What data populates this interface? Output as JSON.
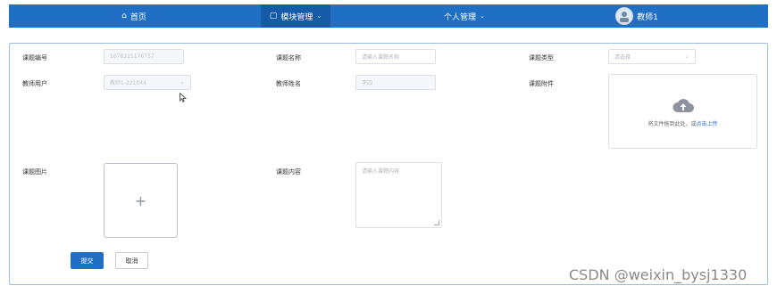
{
  "nav": {
    "home": {
      "icon": "home-icon",
      "label": "首页"
    },
    "module": {
      "icon": "document-icon",
      "label": "模块管理"
    },
    "personal": {
      "label": "个人管理"
    },
    "user": {
      "name": "教师1"
    }
  },
  "form": {
    "course_no": {
      "label": "课题编号",
      "value": "1678215176737"
    },
    "course_name": {
      "label": "课题名称",
      "placeholder": "请输入课题名称"
    },
    "course_type": {
      "label": "课题类型",
      "placeholder": "请选择"
    },
    "teacher_user": {
      "label": "教师用户",
      "value": "教师1-221044"
    },
    "teacher_name": {
      "label": "教师姓名",
      "value": "李四"
    },
    "attachment": {
      "label": "课题附件",
      "text": "将文件拖到此处，或",
      "link": "点击上传"
    },
    "picture": {
      "label": "课题图片",
      "plus": "+"
    },
    "content": {
      "label": "课题内容",
      "placeholder": "请输入课题内容"
    }
  },
  "buttons": {
    "submit": "提交",
    "cancel": "取消"
  },
  "watermark": "CSDN @weixin_bysj1330",
  "colors": {
    "nav_bg": "#1f6fc5",
    "nav_active": "#155ba8",
    "primary": "#1f6fc5"
  }
}
